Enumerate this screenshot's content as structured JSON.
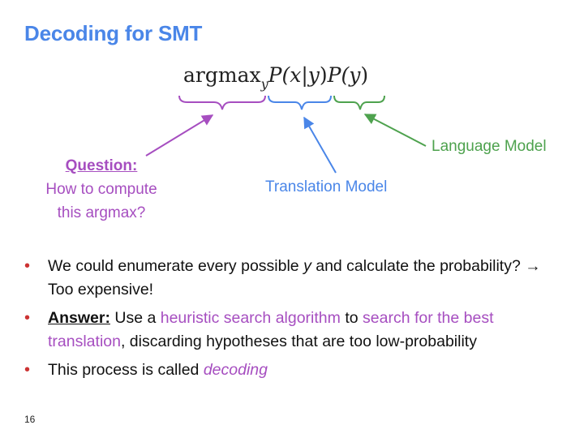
{
  "slide": {
    "title": "Decoding for SMT",
    "page_number": "16"
  },
  "formula": {
    "argmax": "argmax",
    "subscript": "y",
    "p1": "P(",
    "x": "x",
    "bar": "|",
    "y1": "y",
    "close1": ")",
    "p2": "P(",
    "y2": "y",
    "close2": ")"
  },
  "annotations": {
    "question_heading": "Question:",
    "question_line1": "How to compute",
    "question_line2": "this argmax?",
    "translation_model": "Translation Model",
    "language_model": "Language Model"
  },
  "bullets": {
    "b1_pre": "We could enumerate every possible ",
    "b1_var": "y",
    "b1_post": " and calculate the probability?  → Too expensive!",
    "b2_answer": "Answer:",
    "b2_t1": " Use a ",
    "b2_link1": "heuristic search algorithm",
    "b2_t2": " to ",
    "b2_link2": "search for the best translation",
    "b2_t3": ", discarding hypotheses that are too low-probability",
    "b3_pre": "This process is called ",
    "b3_term": "decoding"
  },
  "colors": {
    "title": "#4a86e8",
    "purple": "#a64ec0",
    "blue": "#4a86e8",
    "green": "#4ea24e",
    "bullet": "#cc3333"
  }
}
